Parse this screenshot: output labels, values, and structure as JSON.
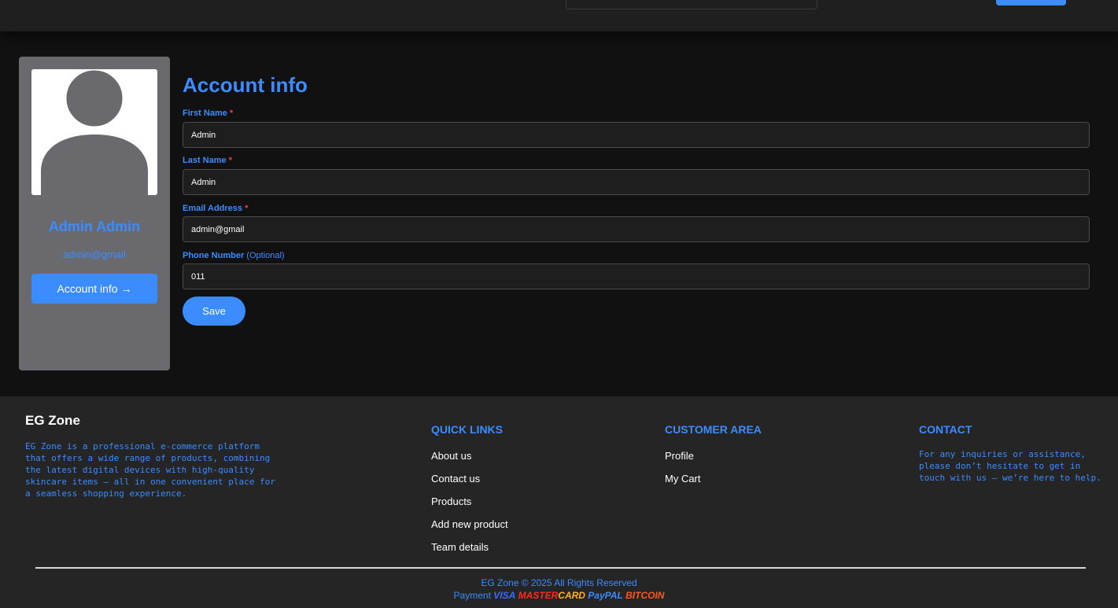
{
  "profile": {
    "name": "Admin Admin",
    "email": "admin@gmail",
    "account_button": "Account info →"
  },
  "form": {
    "title": "Account info",
    "required_mark": "*",
    "fields": [
      {
        "label": "First Name",
        "value": "Admin",
        "required": true
      },
      {
        "label": "Last Name",
        "value": "Admin",
        "required": true
      },
      {
        "label": "Email Address",
        "value": "admin@gmail",
        "required": true
      },
      {
        "label": "Phone Number",
        "value": "011",
        "optional": "(Optional)"
      }
    ],
    "save_label": "Save"
  },
  "footer": {
    "brand": "EG Zone",
    "description": "EG Zone is a professional e-commerce platform that offers a wide range of products, combining the latest digital devices with high-quality skincare items — all in one convenient place for a seamless shopping experience.",
    "quick_links": {
      "title": "QUICK LINKS",
      "items": [
        "About us",
        "Contact us",
        "Products",
        "Add new product",
        "Team details"
      ]
    },
    "customer_area": {
      "title": "CUSTOMER AREA",
      "items": [
        "Profile",
        "My Cart"
      ]
    },
    "contact": {
      "title": "CONTACT",
      "text": "For any inquiries or assistance, please don’t hesitate to get in touch with us — we’re here to help."
    },
    "copyright": "EG Zone © 2025 All Rights Reserved",
    "payment_label": "Payment",
    "payment_methods": {
      "visa": "VISA",
      "master": "MASTER",
      "card": "CARD",
      "paypal": "PayPAL",
      "bitcoin": "BITCOIN"
    }
  },
  "colors": {
    "accent": "#3b8cff",
    "background": "#111111",
    "footer_bg": "#252525",
    "card_bg": "#6a6a6e",
    "required": "#ff3b3b"
  }
}
